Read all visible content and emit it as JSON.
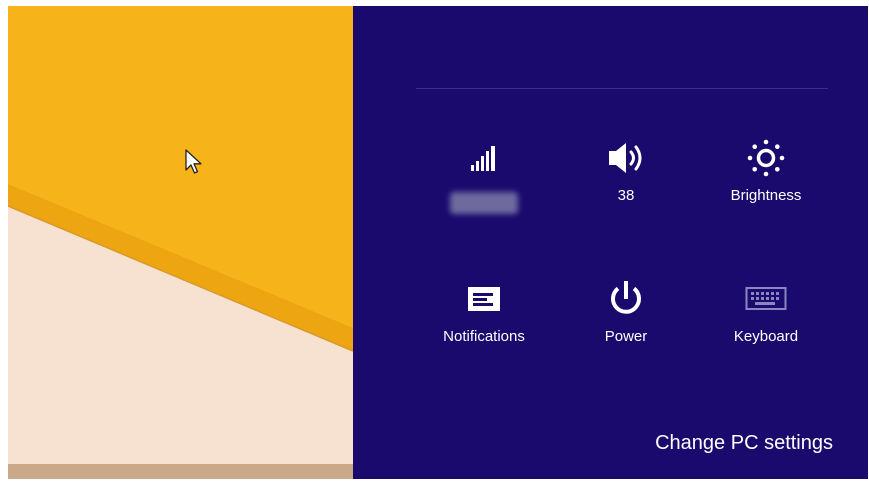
{
  "charm": {
    "background": "#1a0a6e",
    "tiles": [
      {
        "id": "network",
        "icon": "signal-bars-icon",
        "label": ""
      },
      {
        "id": "volume",
        "icon": "speaker-icon",
        "label": "38"
      },
      {
        "id": "brightness",
        "icon": "sun-icon",
        "label": "Brightness"
      },
      {
        "id": "notifications",
        "icon": "notifications-icon",
        "label": "Notifications"
      },
      {
        "id": "power",
        "icon": "power-icon",
        "label": "Power"
      },
      {
        "id": "keyboard",
        "icon": "keyboard-icon",
        "label": "Keyboard"
      }
    ],
    "change_pc_settings": "Change PC settings"
  },
  "wallpaper": {
    "colors": {
      "yellow": "#f6b41a",
      "peach": "#f7e0cf",
      "tan": "#c9a98a"
    }
  }
}
